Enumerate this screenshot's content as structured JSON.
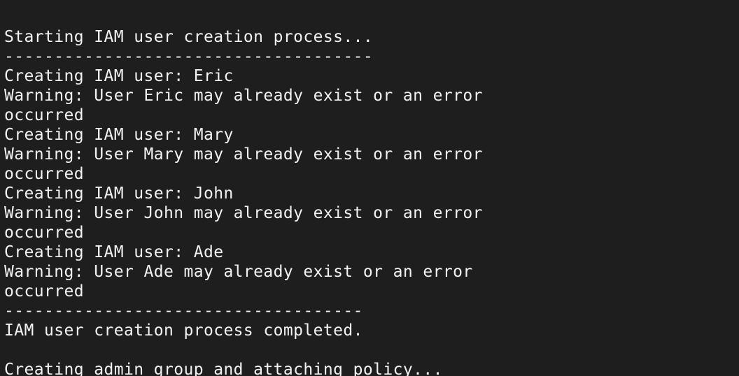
{
  "terminal": {
    "background": "#1e1e1e",
    "foreground": "#f2f2f2",
    "lines": [
      "----------------------------------",
      "",
      "Starting IAM user creation process...",
      "-------------------------------------",
      "Creating IAM user: Eric",
      "Warning: User Eric may already exist or an error",
      "occurred",
      "Creating IAM user: Mary",
      "Warning: User Mary may already exist or an error",
      "occurred",
      "Creating IAM user: John",
      "Warning: User John may already exist or an error",
      "occurred",
      "Creating IAM user: Ade",
      "Warning: User Ade may already exist or an error",
      "occurred",
      "------------------------------------",
      "IAM user creation process completed.",
      "",
      "Creating admin group and attaching policy..."
    ]
  }
}
